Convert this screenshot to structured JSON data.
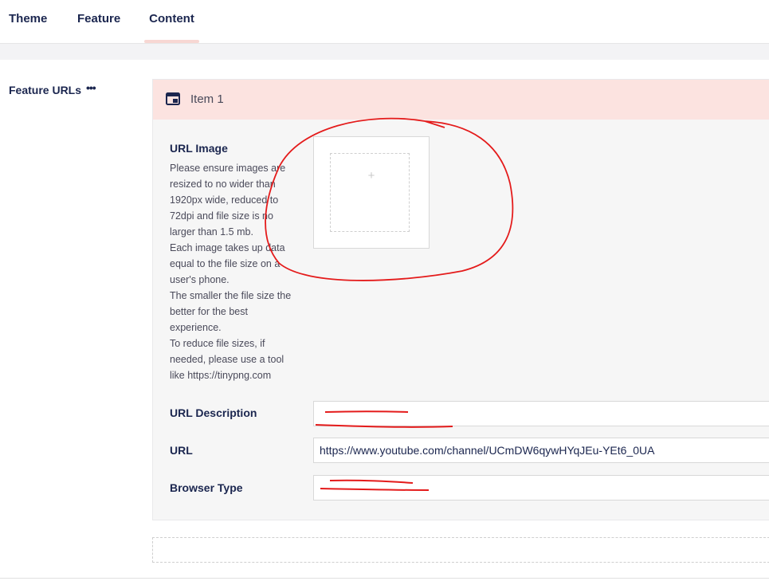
{
  "tabs": [
    {
      "label": "Theme"
    },
    {
      "label": "Feature"
    },
    {
      "label": "Content"
    }
  ],
  "active_tab": "Content",
  "property": {
    "label": "Feature URLs",
    "menu_glyph": "•••"
  },
  "item": {
    "title": "Item 1",
    "icon": "item-block-icon",
    "url_image": {
      "label": "URL Image",
      "description": "Please ensure images are resized to no wider than 1920px wide, reduced to 72dpi and file size is no larger than 1.5 mb.\nEach image takes up data equal to the file size on a user's phone.\nThe smaller the file size the better for the best experience.\nTo reduce file sizes, if needed, please use a tool like https://tinypng.com",
      "add_glyph": "+"
    },
    "url_description": {
      "label": "URL Description",
      "value": ""
    },
    "url": {
      "label": "URL",
      "value": "https://www.youtube.com/channel/UCmDW6qywHYqJEu-YEt6_0UA"
    },
    "browser_type": {
      "label": "Browser Type",
      "value": ""
    }
  },
  "colors": {
    "header_bg": "#fce3e0",
    "active_tab_underline": "#f7d7d3",
    "annotation": "#e41b1b",
    "text_primary": "#1b264f"
  }
}
